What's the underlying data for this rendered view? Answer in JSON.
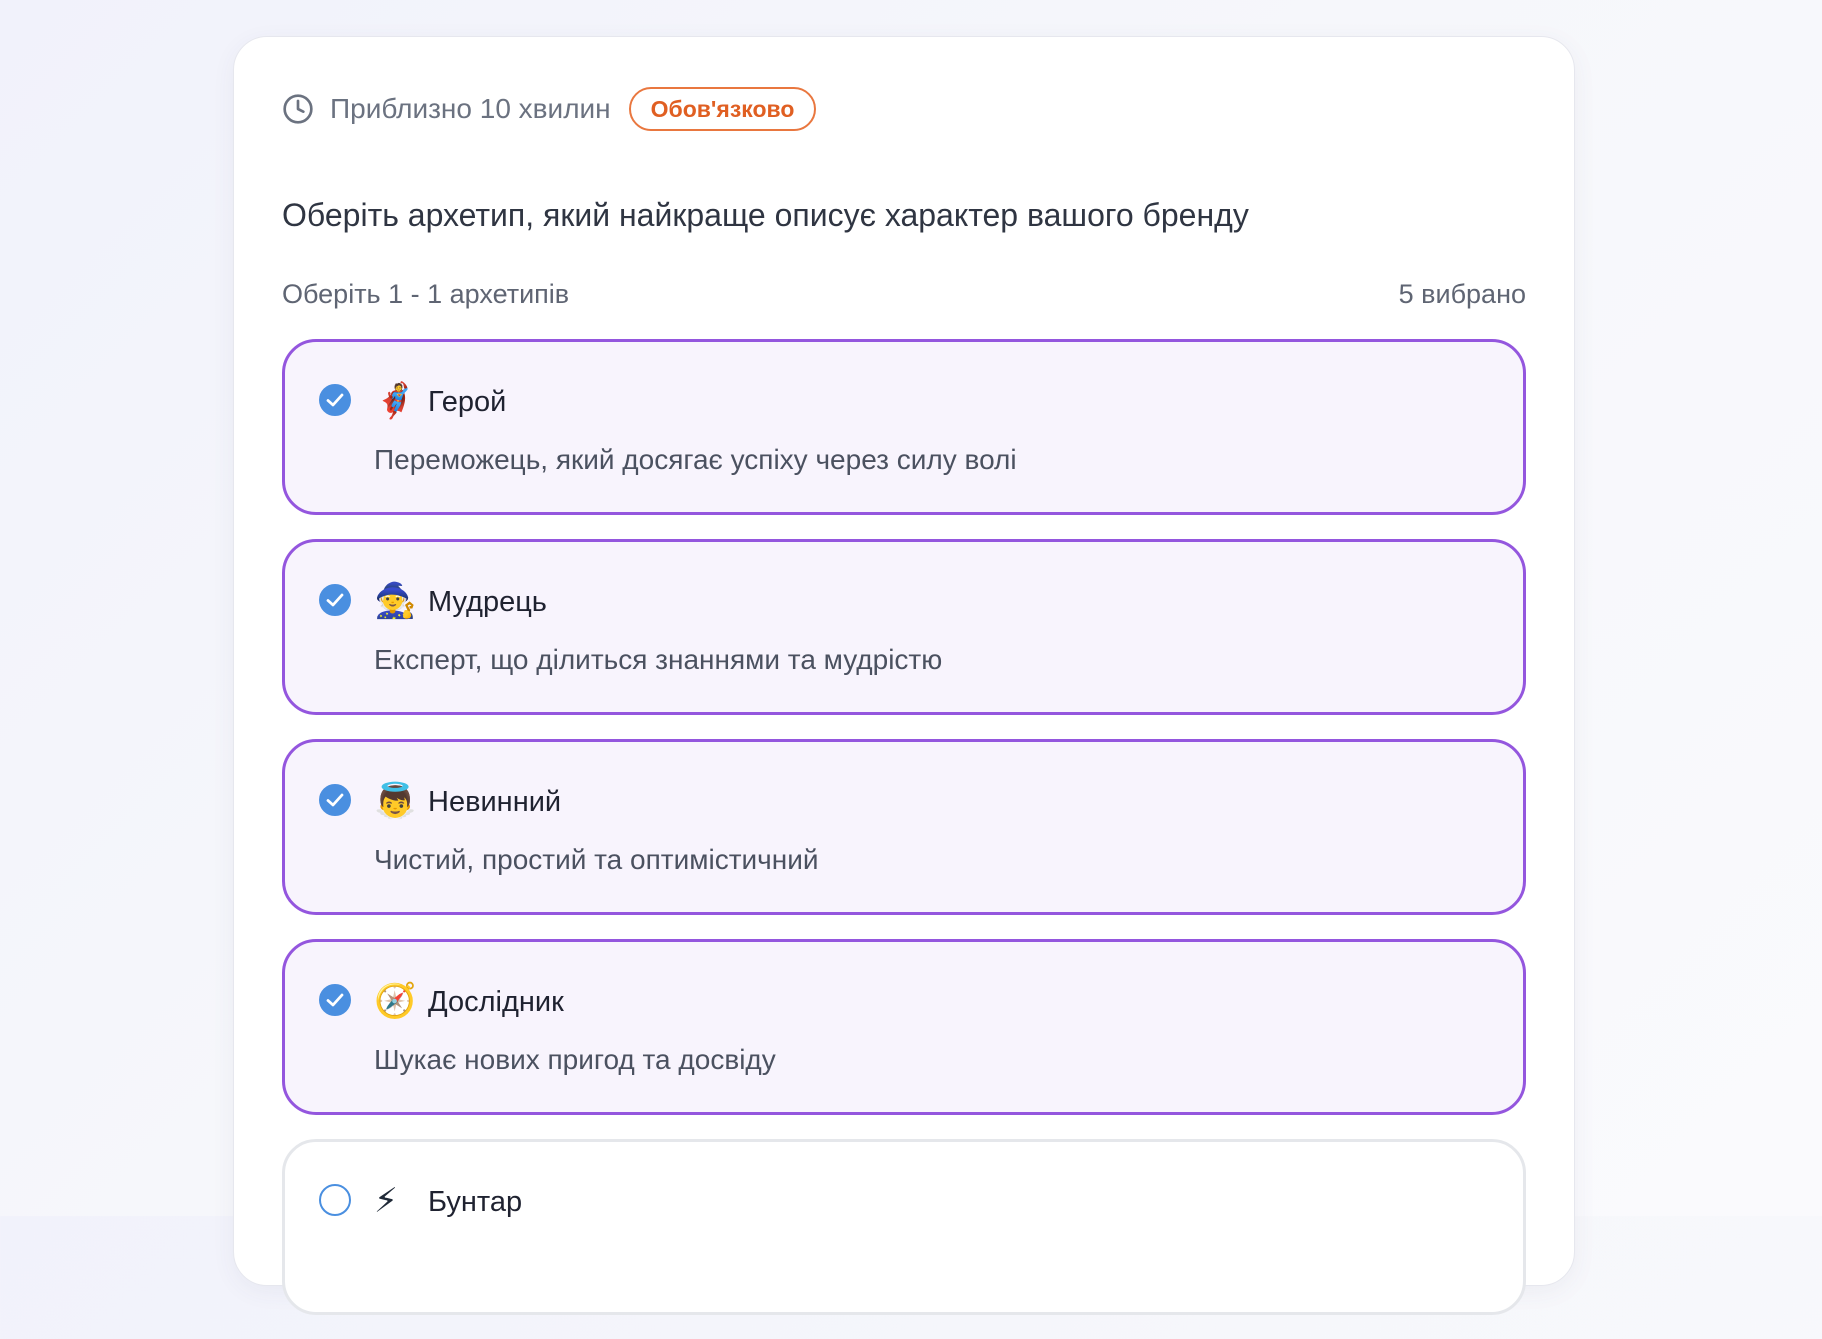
{
  "question": {
    "duration": "Приблизно 10 хвилин",
    "required_badge": "Обов'язково",
    "prompt": "Оберіть архетип, який найкраще описує характер вашого бренду",
    "selection_hint": "Оберіть 1 - 1 архетипів",
    "selected_count": "5 вибрано"
  },
  "options": [
    {
      "emoji": "🦸",
      "icon": "superhero-icon",
      "title": "Герой",
      "description": "Переможець, який досягає успіху через силу волі",
      "selected": true
    },
    {
      "emoji": "🧙",
      "icon": "mage-icon",
      "title": "Мудрець",
      "description": "Експерт, що ділиться знаннями та мудрістю",
      "selected": true
    },
    {
      "emoji": "👼",
      "icon": "angel-icon",
      "title": "Невинний",
      "description": "Чистий, простий та оптимістичний",
      "selected": true
    },
    {
      "emoji": "🧭",
      "icon": "compass-icon",
      "title": "Дослідник",
      "description": "Шукає нових пригод та досвіду",
      "selected": true
    },
    {
      "emoji": "⚡",
      "icon": "lightning-icon",
      "title": "Бунтар",
      "description": "",
      "selected": false
    }
  ],
  "colors": {
    "selected_border": "#9456de",
    "selected_background": "#f8f4fd",
    "checkbox": "#4a8fe0",
    "badge": "#e05f22"
  }
}
